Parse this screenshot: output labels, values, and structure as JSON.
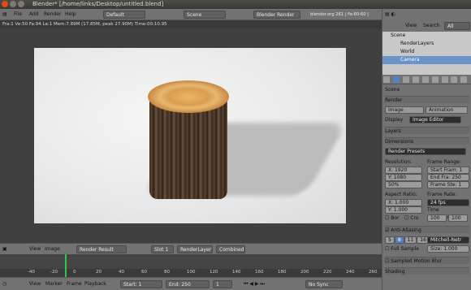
{
  "titlebar": {
    "title": "Blender* [/home/links/Desktop/untitled.blend]"
  },
  "header": {
    "menus": [
      "File",
      "Add",
      "Render",
      "Help"
    ],
    "screen": "Default",
    "scene": "Scene",
    "engine": "Blender Render",
    "info": "blender.org 261 | Fa:60-60 | Fa:36-36 | Cylinder"
  },
  "render_info": "Fra:1 Ve:50 Fa:94 La:1 Mem:7.89M (17.85M, peak 27.90M) Time:00:10.95",
  "image_editor_header": {
    "menus": [
      "View",
      "Image"
    ],
    "image": "Render Result",
    "slot": "Slot 1",
    "layer": "RenderLayer",
    "pass": "Combined"
  },
  "timeline": {
    "ticks": [
      "-40",
      "-20",
      "0",
      "20",
      "40",
      "60",
      "80",
      "100",
      "120",
      "140",
      "160",
      "180",
      "200",
      "220",
      "240",
      "260"
    ],
    "menus": [
      "View",
      "Marker",
      "Frame",
      "Playback"
    ],
    "start": "Start: 1",
    "end": "End: 250",
    "current": "1",
    "sync": "No Sync"
  },
  "outliner": {
    "header": {
      "view": "View",
      "search": "Search",
      "filter": "All Scenes"
    },
    "rows": [
      "Scene",
      "RenderLayers",
      "World",
      "Camera"
    ]
  },
  "properties": {
    "context": "Scene",
    "render_section": "Render",
    "image_button": "Image",
    "animation_button": "Animation",
    "display_label": "Display",
    "display_value": "Image Editor",
    "layers_section": "Layers",
    "dimensions_section": "Dimensions",
    "presets": "Render Presets",
    "resolution_label": "Resolution:",
    "res_x": "X: 1920",
    "res_y": "Y: 1080",
    "res_pct": "50%",
    "frame_range_label": "Frame Range:",
    "start_frame": "Start Fram: 1",
    "end_frame": "End Fra: 250",
    "frame_step": "Frame Ste: 1",
    "aspect_label": "Aspect Ratio:",
    "aspect_x": "X: 1.000",
    "aspect_y": "Y: 1.000",
    "frame_rate_label": "Frame Rate:",
    "fps": "24 fps",
    "remap_label": "Time Remapping:",
    "remap_old": "100",
    "remap_new": "100",
    "bor": "Bor",
    "crop": "Cro",
    "aa_label": "Anti-Aliasing",
    "aa_samples": [
      "5",
      "8",
      "11",
      "16"
    ],
    "aa_filter": "Mitchell-Netr",
    "full_sample": "Full Sample",
    "size": "Size: 1.000",
    "motion_blur": "Sampled Motion Blur",
    "shading": "Shading"
  }
}
